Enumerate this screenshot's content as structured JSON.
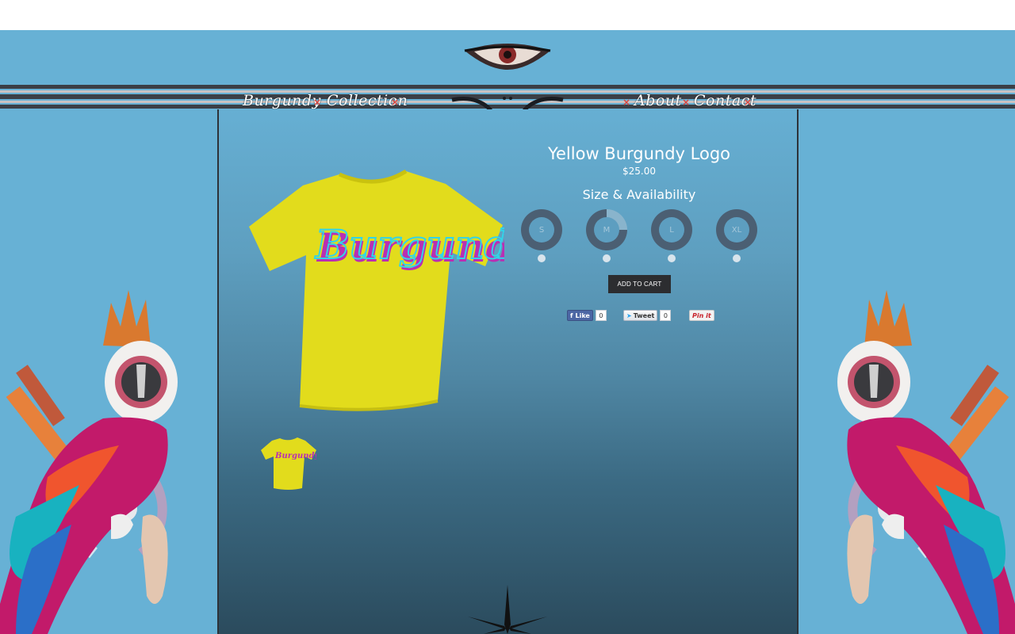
{
  "nav": {
    "left": [
      "Burgundy",
      "Collection"
    ],
    "right": [
      "About",
      "Contact"
    ],
    "separator": "×"
  },
  "product": {
    "title": "Yellow Burgundy Logo",
    "price": "$25.00",
    "size_heading": "Size & Availability",
    "sizes": [
      {
        "label": "S",
        "availability": 1.0
      },
      {
        "label": "M",
        "availability": 0.75
      },
      {
        "label": "L",
        "availability": 1.0
      },
      {
        "label": "XL",
        "availability": 1.0
      }
    ],
    "add_to_cart": "ADD TO CART",
    "shirt_color": "#e2dc1c",
    "shirt_print": "Burgundy"
  },
  "social": {
    "facebook": {
      "label": "Like",
      "count": "0"
    },
    "twitter": {
      "label": "Tweet",
      "count": "0"
    },
    "pinterest": {
      "label": "Pin it"
    }
  },
  "colors": {
    "background": "#67b1d5",
    "nav_bar": "#3b3f46",
    "accent_red": "#d9463f",
    "button": "#2c2d30",
    "ring": "#4b5f73"
  }
}
